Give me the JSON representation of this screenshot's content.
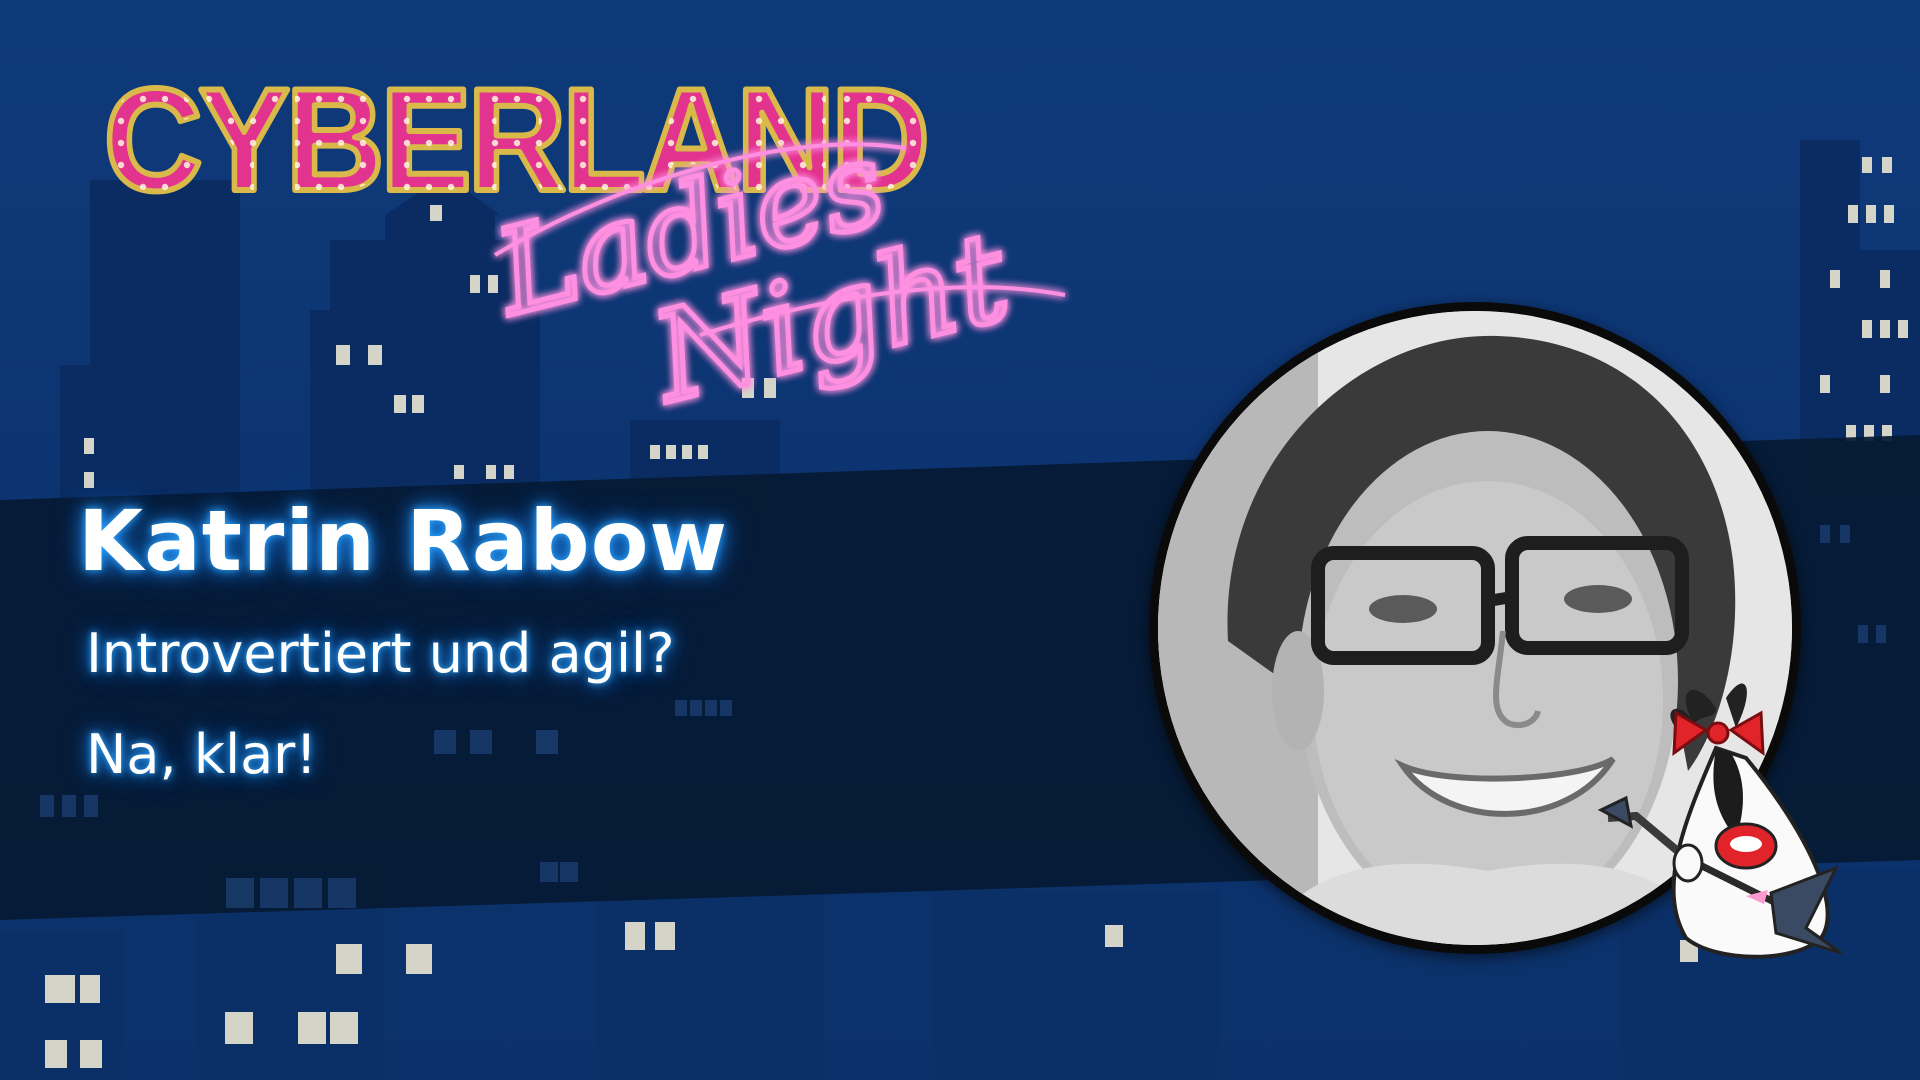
{
  "logo": {
    "wordmark": "CYBERLAND",
    "script_line_1": "Ladies",
    "script_line_2": "Night"
  },
  "speaker": {
    "name": "Katrin Rabow",
    "talk_title_line_1": "Introvertiert und agil?",
    "talk_title_line_2": "Na, klar!"
  },
  "colors": {
    "background": "#0c3471",
    "band": "#061a33",
    "building": "#0a2c62",
    "window": "#d4d4c8",
    "wordmark_fill": "#e2338f",
    "wordmark_outline": "#d8b94a",
    "script_neon": "#ff8fe0",
    "title_glow": "#2ea8ff"
  },
  "icons": {
    "portrait": "speaker-photo",
    "mascot": "duke-mascot-with-guitar-and-bow"
  }
}
